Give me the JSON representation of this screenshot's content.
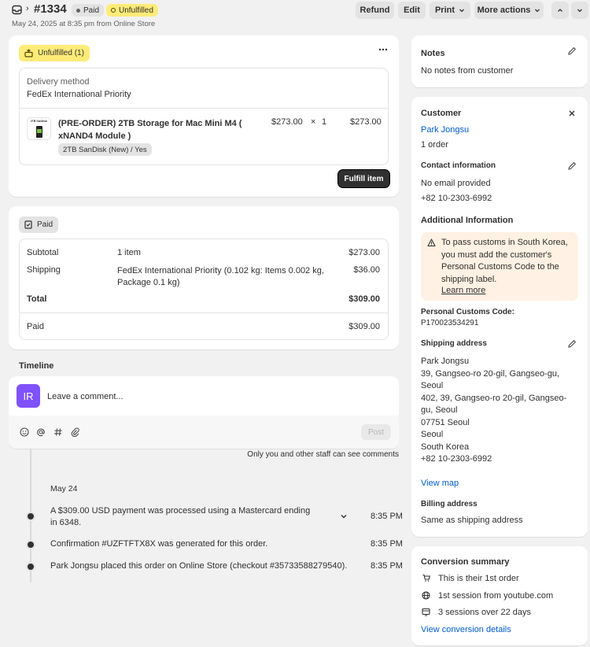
{
  "header": {
    "order_number": "#1334",
    "paid_badge": "Paid",
    "unfulfilled_badge": "Unfulfilled",
    "subtitle": "May 24, 2025 at 8:35 pm from Online Store",
    "refund": "Refund",
    "edit": "Edit",
    "print": "Print",
    "more_actions": "More actions"
  },
  "fulfillment": {
    "badge": "Unfulfilled (1)",
    "delivery_label": "Delivery method",
    "delivery_value": "FedEx International Priority",
    "item_title": "(PRE-ORDER) 2TB Storage for Mac Mini M4 ( xNAND4 Module )",
    "item_variant": "2TB SanDisk (New) / Yes",
    "item_price": "$273.00",
    "item_times": "×",
    "item_qty": "1",
    "item_total": "$273.00",
    "thumb_text": "2TB SanDisk",
    "fulfill_button": "Fulfill item"
  },
  "payment": {
    "badge": "Paid",
    "subtotal_label": "Subtotal",
    "subtotal_desc": "1 item",
    "subtotal_value": "$273.00",
    "shipping_label": "Shipping",
    "shipping_desc": "FedEx International Priority (0.102 kg: Items 0.002 kg, Package 0.1 kg)",
    "shipping_value": "$36.00",
    "total_label": "Total",
    "total_value": "$309.00",
    "paid_label": "Paid",
    "paid_value": "$309.00"
  },
  "timeline": {
    "title": "Timeline",
    "avatar": "IR",
    "comment_placeholder": "Leave a comment...",
    "post": "Post",
    "staff_note": "Only you and other staff can see comments",
    "date": "May 24",
    "events": [
      {
        "text": "A $309.00 USD payment was processed using a Mastercard ending in 6348.",
        "time": "8:35 PM"
      },
      {
        "text": "Confirmation #UZFTFTX8X was generated for this order.",
        "time": "8:35 PM"
      },
      {
        "text": "Park Jongsu placed this order on Online Store (checkout #35733588279540).",
        "time": "8:35 PM"
      }
    ]
  },
  "notes": {
    "title": "Notes",
    "body": "No notes from customer"
  },
  "customer": {
    "title": "Customer",
    "name": "Park Jongsu",
    "orders": "1 order",
    "contact_title": "Contact information",
    "email": "No email provided",
    "phone": "+82 10-2303-6992",
    "additional_title": "Additional Information",
    "warning": "To pass customs in South Korea, you must add the customer's Personal Customs Code to the shipping label.",
    "learn_more": "Learn more",
    "pcc_label": "Personal Customs Code:",
    "pcc_value": "P170023534291",
    "shipping_title": "Shipping address",
    "address_lines": [
      "Park Jongsu",
      "39, Gangseo-ro 20-gil, Gangseo-gu, Seoul",
      "402, 39, Gangseo-ro 20-gil, Gangseo-gu, Seoul",
      "07751 Seoul",
      "Seoul",
      "South Korea",
      "+82 10-2303-6992"
    ],
    "view_map": "View map",
    "billing_title": "Billing address",
    "billing_value": "Same as shipping address"
  },
  "conversion": {
    "title": "Conversion summary",
    "items": [
      "This is their 1st order",
      "1st session from youtube.com",
      "3 sessions over 22 days"
    ],
    "details_link": "View conversion details"
  }
}
